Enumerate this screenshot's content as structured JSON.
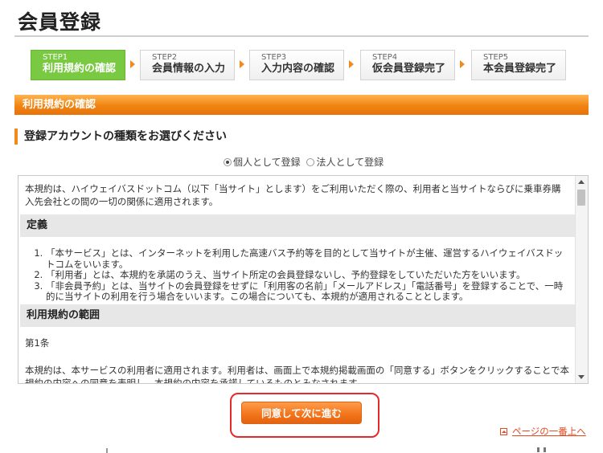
{
  "page": {
    "title": "会員登録"
  },
  "steps": [
    {
      "num": "STEP1",
      "label": "利用規約の確認"
    },
    {
      "num": "STEP2",
      "label": "会員情報の入力"
    },
    {
      "num": "STEP3",
      "label": "入力内容の確認"
    },
    {
      "num": "STEP4",
      "label": "仮会員登録完了"
    },
    {
      "num": "STEP5",
      "label": "本会員登録完了"
    }
  ],
  "section": {
    "title": "利用規約の確認"
  },
  "account_type": {
    "heading": "登録アカウントの種類をお選びください",
    "options": [
      "個人として登録",
      "法人として登録"
    ],
    "selected": "個人として登録"
  },
  "terms": {
    "intro": "本規約は、ハイウェイバスドットコム（以下「当サイト」とします）をご利用いただく際の、利用者と当サイトならびに乗車券購入先会社との間の一切の関係に適用されます。",
    "definitions_heading": "定義",
    "definitions": [
      "「本サービス」とは、インターネットを利用した高速バス予約等を目的として当サイトが主催、運営するハイウェイバスドットコムをいいます。",
      "「利用者」とは、本規約を承諾のうえ、当サイト所定の会員登録ないし、予約登録をしていただいた方をいいます。",
      "「非会員予約」とは、当サイトの会員登録をせずに「利用客の名前」「メールアドレス」「電話番号」を登録することで、一時的に当サイトの利用を行う場合をいいます。この場合についても、本規約が適用されることとします。"
    ],
    "scope_heading": "利用規約の範囲",
    "article": "第1条",
    "article_body": "本規約は、本サービスの利用者に適用されます。利用者は、画面上で本規約掲載画面の「同意する」ボタンをクリックすることで本規約の内容への同意を表明し、本規約の内容を承諾しているものとみなされます。"
  },
  "agree_button": {
    "label": "同意して次に進む"
  },
  "page_top_link": {
    "label": "ページの一番上へ"
  },
  "colors": {
    "accent": "#f08a1c",
    "active_step": "#7ac943",
    "highlight_frame": "#e52a2a"
  }
}
